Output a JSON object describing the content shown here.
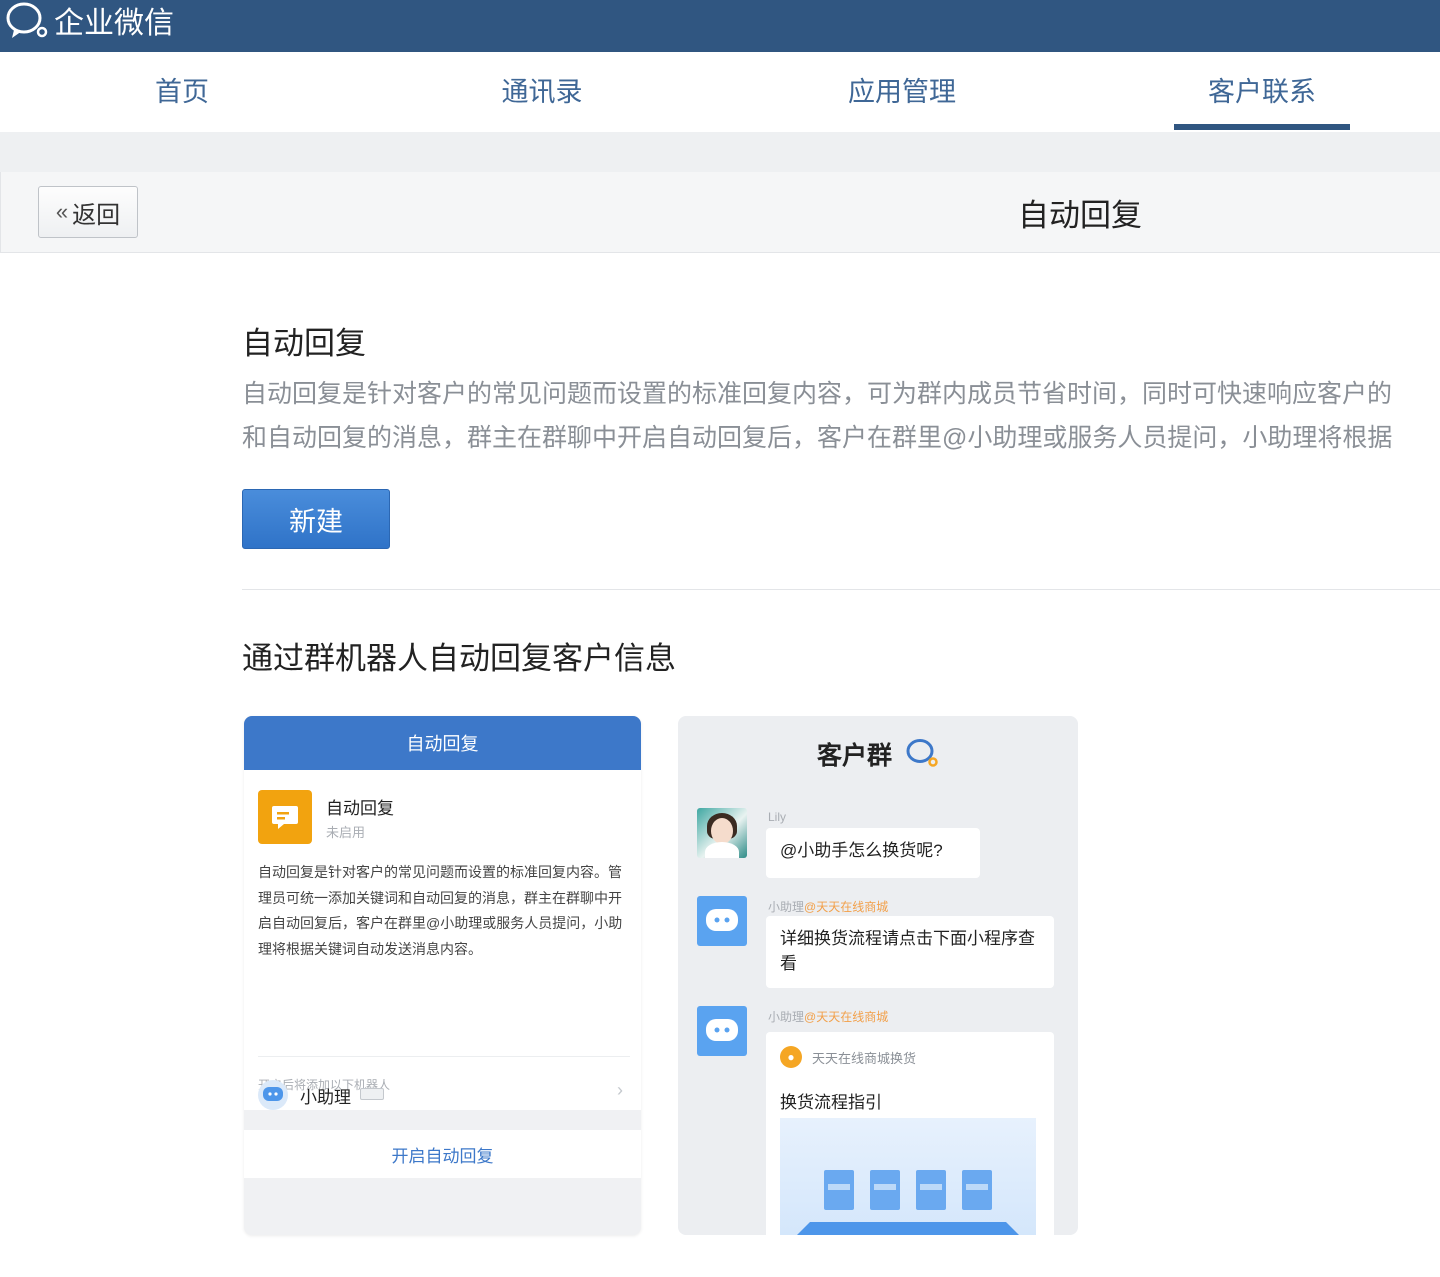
{
  "app": {
    "title": "企业微信"
  },
  "nav": {
    "tabs": [
      {
        "label": "首页",
        "active": false
      },
      {
        "label": "通讯录",
        "active": false
      },
      {
        "label": "应用管理",
        "active": false
      },
      {
        "label": "客户联系",
        "active": true
      }
    ]
  },
  "header": {
    "back_label": "返回",
    "title": "自动回复"
  },
  "main": {
    "section_title": "自动回复",
    "description_line1": "自动回复是针对客户的常见问题而设置的标准回复内容，可为群内成员节省时间，同时可快速响应客户的",
    "description_line2": "和自动回复的消息，群主在群聊中开启自动回复后，客户在群里@小助理或服务人员提问，小助理将根据",
    "new_button": "新建",
    "section2_title": "通过群机器人自动回复客户信息"
  },
  "phone1": {
    "header": "自动回复",
    "item_name": "自动回复",
    "item_status": "未启用",
    "item_desc": "自动回复是针对客户的常见问题而设置的标准回复内容。管理员可统一添加关键词和自动回复的消息，群主在群聊中开启自动回复后，客户在群里@小助理或服务人员提问，小助理将根据关键词自动发送消息内容。",
    "hint": "开启后将添加以下机器人",
    "robot_name": "小助理",
    "enable_label": "开启自动回复"
  },
  "phone2": {
    "title": "客户群",
    "messages": [
      {
        "sender": "Lily",
        "org": "",
        "text": "@小助手怎么换货呢?"
      },
      {
        "sender": "小助理",
        "org": "@天天在线商城",
        "text": "详细换货流程请点击下面小程序查看"
      },
      {
        "sender": "小助理",
        "org": "@天天在线商城",
        "text": ""
      }
    ],
    "card": {
      "source": "天天在线商城换货",
      "title": "换货流程指引"
    }
  },
  "colors": {
    "topbar": "#305681",
    "accent": "#3d78c9",
    "button": "#2f73c8",
    "orange": "#f2a30f"
  }
}
